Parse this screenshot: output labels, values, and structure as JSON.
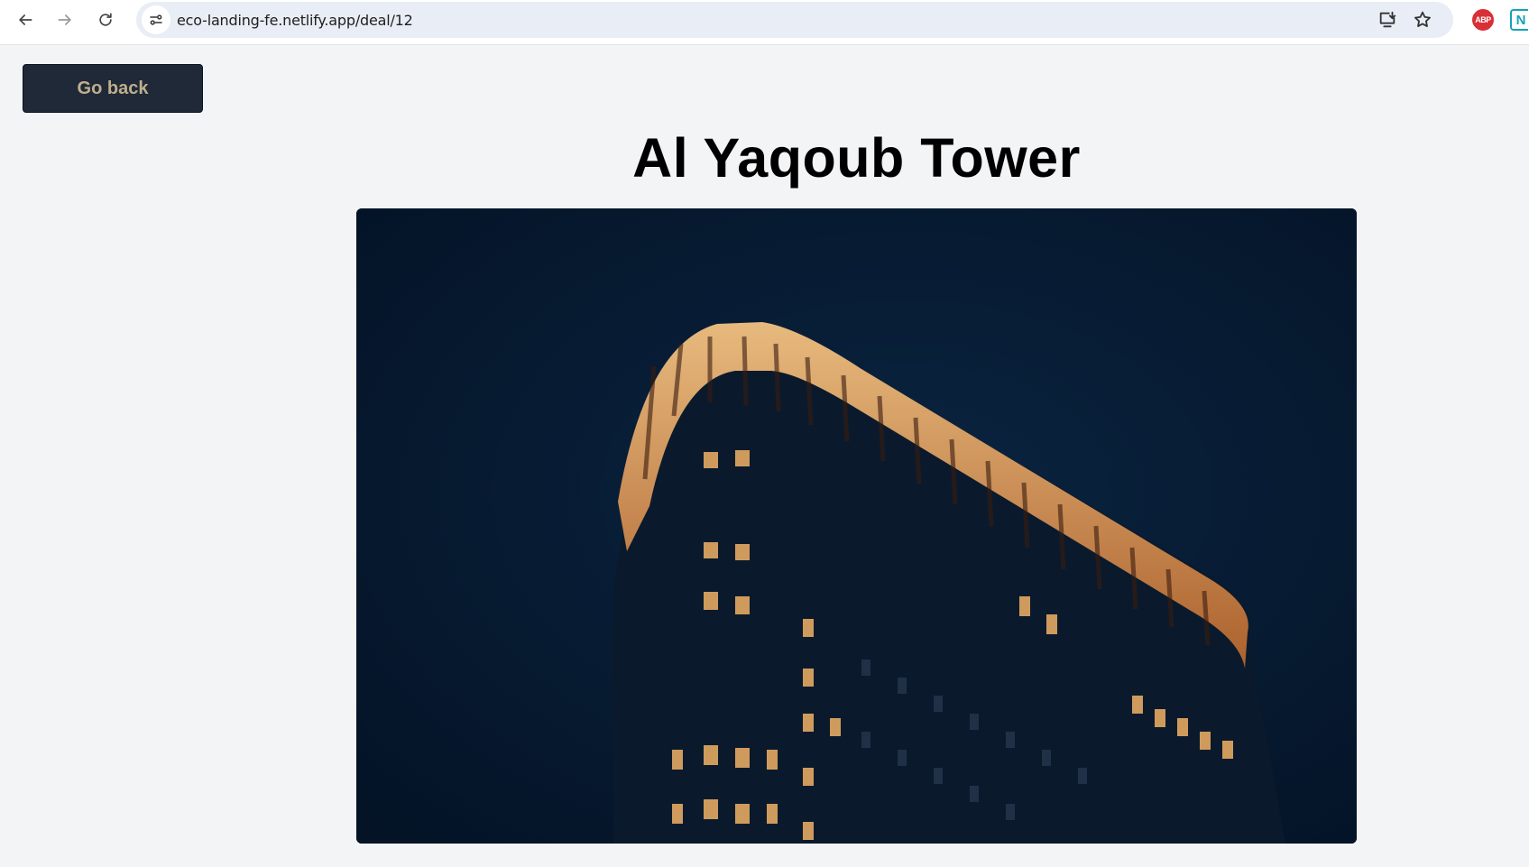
{
  "browser": {
    "url": "eco-landing-fe.netlify.app/deal/12",
    "icons": [
      "back-arrow-icon",
      "forward-arrow-icon",
      "reload-icon",
      "site-info-icon",
      "install-app-icon",
      "bookmark-star-icon",
      "adblock-plus-icon",
      "extension-n-icon"
    ],
    "abp_label": "ABP",
    "n_ext_label": "N"
  },
  "page": {
    "go_back_label": "Go back",
    "title": "Al Yaqoub Tower",
    "hero_image": "night-tower-photo"
  },
  "colors": {
    "page_bg": "#f3f4f6",
    "button_bg": "#1f2937",
    "button_text": "#bfae8e",
    "title": "#000000",
    "image_bg": "#061a30"
  }
}
